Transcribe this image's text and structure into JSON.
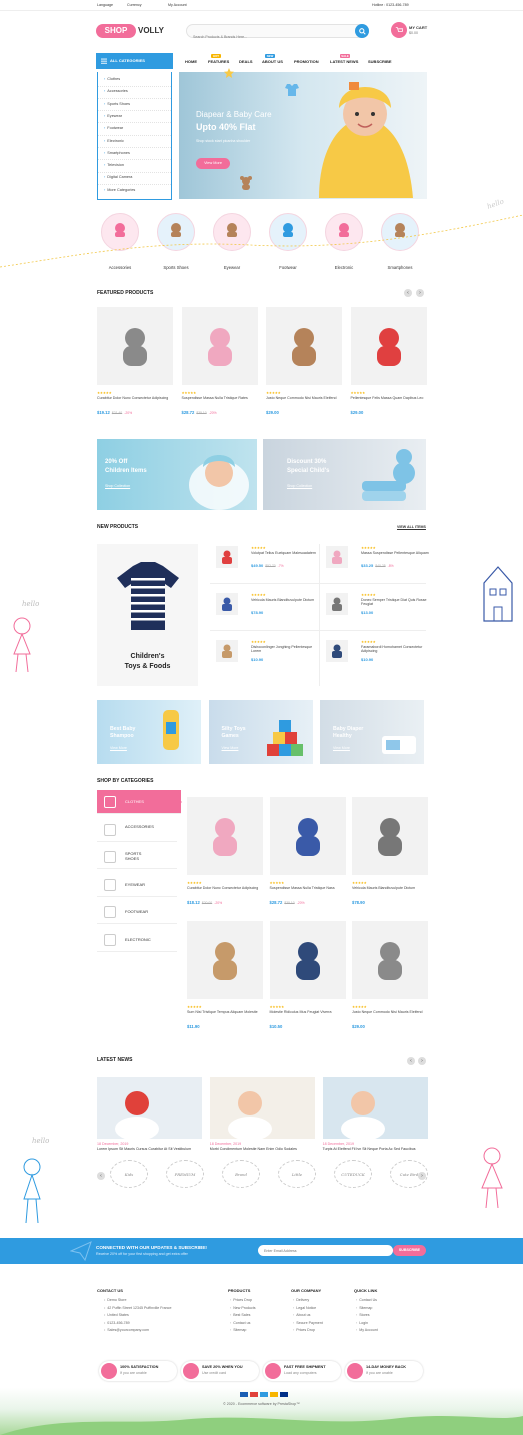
{
  "topbar": {
    "language": "Language",
    "currency": "Currency",
    "account": "My Account",
    "hotline": "Hotline : 0123-456-789"
  },
  "logo": {
    "part1": "SHOP",
    "part2": "VOLLY"
  },
  "search": {
    "placeholder": "Search Products & Brands Here..."
  },
  "cart": {
    "label": "MY CART",
    "amount": "$0.00"
  },
  "nav": {
    "all_categories": "ALL CATEGORIES",
    "items": [
      {
        "label": "HOME",
        "badge": ""
      },
      {
        "label": "FEATURES",
        "badge": "HOT"
      },
      {
        "label": "DEALS",
        "badge": ""
      },
      {
        "label": "ABOUT US",
        "badge": "NEW"
      },
      {
        "label": "PROMOTION",
        "badge": ""
      },
      {
        "label": "LATEST NEWS",
        "badge": "SALE"
      },
      {
        "label": "SUBSCRIBE",
        "badge": ""
      }
    ]
  },
  "categories_menu": [
    "Clothes",
    "Accessories",
    "Sports Shoes",
    "Eyewear",
    "Footwear",
    "Electronic",
    "Smartphones",
    "Television",
    "Digital Camera",
    "More Categories"
  ],
  "hero": {
    "title": "Diapear & Baby Care",
    "subtitle": "Upto 40% Flat",
    "text": "Shop stock start picanha shoulder",
    "button": "View More"
  },
  "circle_categories": [
    "Accessories",
    "Sports Shoes",
    "Eyewear",
    "Footwear",
    "Electronic",
    "Smartphones"
  ],
  "featured": {
    "title": "FEATURED PRODUCTS",
    "products": [
      {
        "name": "Curabitur Dolor Nunc Consectetur Adipiscing",
        "price": "$19.12",
        "old": "$21.40",
        "off": "-20%"
      },
      {
        "name": "Suspendisse Massa Nulla Tristique Rates",
        "price": "$28.72",
        "old": "$35.10",
        "off": "-20%"
      },
      {
        "name": "Justo Neque Commodo Nisi Mauris Eleifend",
        "price": "$29.00",
        "old": "",
        "off": ""
      },
      {
        "name": "Pellentesque Felis Massa Quam Dapibus Leo",
        "price": "$29.00",
        "old": "",
        "off": ""
      }
    ]
  },
  "promo_banners": [
    {
      "line1": "20% Off",
      "line2": "Children Items",
      "link": "Shop Collection"
    },
    {
      "line1": "Discount 30%",
      "line2": "Special Child's",
      "link": "Shop Collection"
    }
  ],
  "new_products": {
    "title": "NEW PRODUCTS",
    "view_all": "VIEW ALL ITEMS",
    "feature_title1": "Children's",
    "feature_title2": "Toys & Foods",
    "items": [
      {
        "name": "Volutpat Tellus Euelquam Malesuadatem",
        "price": "$49.50",
        "old": "$52.70",
        "off": "-7%"
      },
      {
        "name": "Massa Suspendisse Pellentesque Aliquam",
        "price": "$33.25",
        "old": "$40.25",
        "off": "-8%"
      },
      {
        "name": "Vehicula Mauris Blandituvulpute Dictum",
        "price": "$78.90",
        "old": "",
        "off": ""
      },
      {
        "name": "Donec Semper Tristique Diat Quis Rosse Feugiat",
        "price": "$13.00",
        "old": "",
        "off": ""
      },
      {
        "name": "Dishoconlinger Jonghing Pellentesque Lorem",
        "price": "$10.90",
        "old": "",
        "off": ""
      },
      {
        "name": "Faramabordi Homohamet Consectetur Adipiscing",
        "price": "$10.90",
        "old": "",
        "off": ""
      }
    ]
  },
  "mini_banners": [
    {
      "line1": "Best Baby",
      "line2": "Shampoo",
      "link": "View More"
    },
    {
      "line1": "Silty Toys",
      "line2": "Games",
      "link": "View More"
    },
    {
      "line1": "Baby Diaper",
      "line2": "Healthy",
      "link": "View More"
    }
  ],
  "shop_by_categories": {
    "title": "SHOP BY CATEGORIES",
    "tabs": [
      "CLOTHES",
      "ACCESSORIES",
      "SPORTS SHOES",
      "EYEWEAR",
      "FOOTWEAR",
      "ELECTRONIC"
    ],
    "products": [
      {
        "name": "Curabitur Dolor Nunc Consectetur Adipiscing",
        "price": "$18.12",
        "old": "$20.00",
        "off": "-20%"
      },
      {
        "name": "Suspendisse Massa Nulla Tristique Nass",
        "price": "$28.72",
        "old": "$35.10",
        "off": "-20%"
      },
      {
        "name": "Vehicula Mauris Blandituvulpute Dictum",
        "price": "$78.90",
        "old": "",
        "off": ""
      },
      {
        "name": "Sum Nisi Tristique Tempus Aliquam Molestie",
        "price": "$11.90",
        "old": "",
        "off": ""
      },
      {
        "name": "Molestie Ridiculus Mus Feugiat Viverra",
        "price": "$10.50",
        "old": "",
        "off": ""
      },
      {
        "name": "Justo Neque Commodo Nisi Mauris Eleifend",
        "price": "$29.00",
        "old": "",
        "off": ""
      }
    ]
  },
  "news": {
    "title": "LATEST NEWS",
    "items": [
      {
        "date": "18 December, 2019",
        "title": "Lorem Ipsum Sit Mauris Cursus Curabitur At Sit Vestibulum"
      },
      {
        "date": "18 December, 2019",
        "title": "Morbi Condimentum Molestie Nam Enim Odio Sodales"
      },
      {
        "date": "18 December, 2019",
        "title": "Turpis At Eleifend Fil Ivn Sit Neque Porta Ac Sed Faucibus"
      }
    ]
  },
  "brands": [
    "Kids",
    "PREMIUM",
    "Brand",
    "Little",
    "CUTEDUCK",
    "Cute Bird"
  ],
  "newsletter": {
    "title": "CONNECTED WITH OUR UPDATES & SUBSCRIBE!",
    "text": "Receive 20% off for your first shopping and get extra offer",
    "placeholder": "Enter Email Address",
    "button": "SUBSCRIBE"
  },
  "footer": {
    "contact_title": "CONTACT US",
    "contact": [
      "Demo Store",
      "42 Puffin Street 12345 Puffinville France",
      "United States",
      "0123-456-789",
      "Sales@yourcompany.com"
    ],
    "products_title": "PRODUCTS",
    "products": [
      "Prices Drop",
      "New Products",
      "Best Sales",
      "Contact us",
      "Sitemap"
    ],
    "company_title": "OUR COMPANY",
    "company": [
      "Delivery",
      "Legal Notice",
      "About us",
      "Secure Payment",
      "Prices Drop"
    ],
    "quick_title": "QUICK LINK",
    "quick": [
      "Contact Us",
      "Sitemap",
      "Stores",
      "Login",
      "My Account"
    ]
  },
  "features": [
    {
      "title": "100% SATISFACTION",
      "text": "If you are unable"
    },
    {
      "title": "SAVE 20% WHEN YOU",
      "text": "Use credit card"
    },
    {
      "title": "FAST FREE SHIPMENT",
      "text": "Load any computers"
    },
    {
      "title": "14-DAY MONEY BACK",
      "text": "If you are unable"
    }
  ],
  "copyright": "© 2020 - Ecommerce software by PrestaShop™",
  "decor": {
    "hello": "hello"
  },
  "colors": {
    "pink": "#f26d9a",
    "blue": "#2f9be0"
  }
}
